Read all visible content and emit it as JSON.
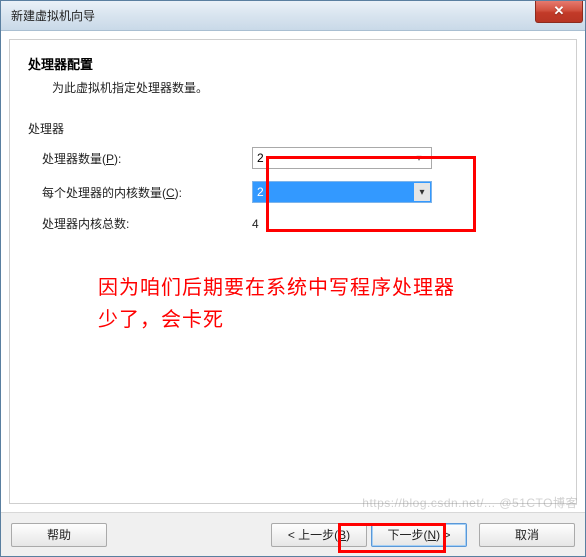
{
  "window": {
    "title": "新建虚拟机向导",
    "close_glyph": "✕"
  },
  "header": {
    "title": "处理器配置",
    "subtitle": "为此虚拟机指定处理器数量。"
  },
  "section": {
    "label": "处理器"
  },
  "fields": {
    "processor_count": {
      "label_prefix": "处理器数量(",
      "hotkey": "P",
      "label_suffix": "):",
      "value": "2"
    },
    "cores_per_processor": {
      "label_prefix": "每个处理器的内核数量(",
      "hotkey": "C",
      "label_suffix": "):",
      "value": "2"
    },
    "total_cores": {
      "label": "处理器内核总数:",
      "value": "4"
    }
  },
  "annotation": {
    "text": "因为咱们后期要在系统中写程序处理器少了，会卡死",
    "color": "#ff0000",
    "highlighted_elements": [
      "processor-dropdowns",
      "next-button"
    ]
  },
  "buttons": {
    "help": "帮助",
    "back_prefix": "< 上一步(",
    "back_hotkey": "B",
    "back_suffix": ")",
    "next_prefix": "下一步(",
    "next_hotkey": "N",
    "next_suffix": ") >",
    "cancel": "取消"
  },
  "watermark": "https://blog.csdn.net/... @51CTO博客"
}
